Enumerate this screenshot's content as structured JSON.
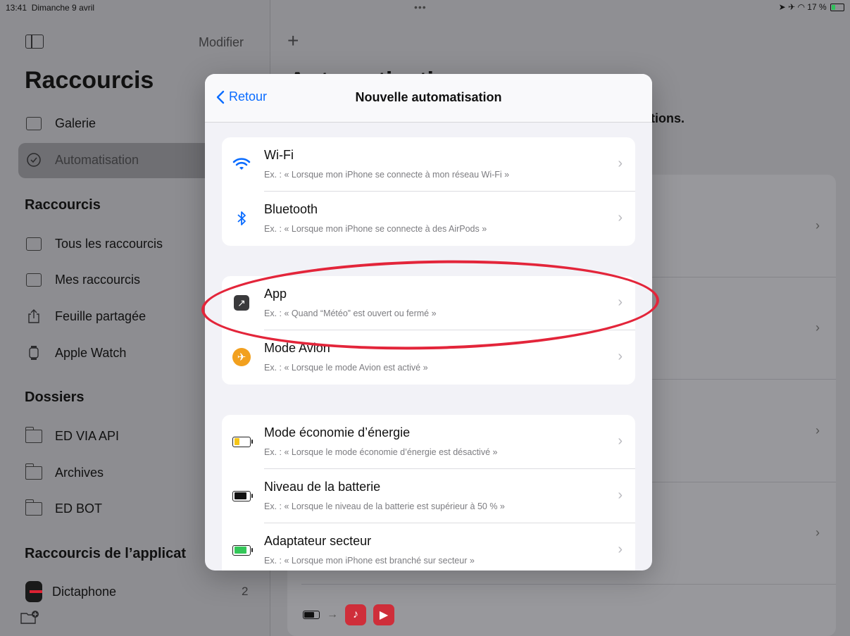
{
  "status_bar": {
    "time": "13:41",
    "date": "Dimanche 9 avril",
    "multitask_dots": "•••",
    "battery_percent": "17 %"
  },
  "sidebar": {
    "edit_label": "Modifier",
    "title": "Raccourcis",
    "top_items": [
      {
        "label": "Galerie",
        "icon": "gallery-icon"
      },
      {
        "label": "Automatisation",
        "icon": "clock-check-icon",
        "selected": true
      }
    ],
    "section_shortcuts": "Raccourcis",
    "shortcut_items": [
      {
        "label": "Tous les raccourcis",
        "icon": "stack-icon"
      },
      {
        "label": "Mes raccourcis",
        "icon": "person-stack-icon"
      },
      {
        "label": "Feuille partagée",
        "icon": "share-icon"
      },
      {
        "label": "Apple Watch",
        "icon": "watch-icon"
      }
    ],
    "section_folders": "Dossiers",
    "folders": [
      {
        "label": "ED VIA API"
      },
      {
        "label": "Archives"
      },
      {
        "label": "ED BOT"
      }
    ],
    "section_app_shortcuts": "Raccourcis de l’applicat",
    "app_shortcuts": [
      {
        "label": "Dictaphone",
        "count": "2"
      }
    ]
  },
  "main": {
    "title": "Automatisation",
    "subtitle_fragment": "tions."
  },
  "modal": {
    "back_label": "Retour",
    "title": "Nouvelle automatisation",
    "groups": [
      [
        {
          "title": "Wi-Fi",
          "subtitle": "Ex. : « Lorsque mon iPhone se connecte à mon réseau Wi-Fi »",
          "icon": "wifi-icon"
        },
        {
          "title": "Bluetooth",
          "subtitle": "Ex. : « Lorsque mon iPhone se connecte à des AirPods »",
          "icon": "bluetooth-icon"
        }
      ],
      [
        {
          "title": "App",
          "subtitle": "Ex. : « Quand “Météo” est ouvert ou fermé »",
          "icon": "app-icon",
          "highlighted": true
        },
        {
          "title": "Mode Avion",
          "subtitle": "Ex. : « Lorsque le mode Avion est activé »",
          "icon": "airplane-icon"
        }
      ],
      [
        {
          "title": "Mode économie d’énergie",
          "subtitle": "Ex. : « Lorsque le mode économie d’énergie est désactivé »",
          "icon": "low-power-battery-icon"
        },
        {
          "title": "Niveau de la batterie",
          "subtitle": "Ex. : « Lorsque le niveau de la batterie est supérieur à 50 % »",
          "icon": "battery-level-icon"
        },
        {
          "title": "Adaptateur secteur",
          "subtitle": "Ex. : « Lorsque mon iPhone est branché sur secteur »",
          "icon": "charging-battery-icon"
        }
      ]
    ]
  },
  "colors": {
    "accent_blue": "#0a6cff",
    "highlight_red": "#e3253a",
    "airplane_orange": "#f2a01e",
    "low_power_yellow": "#f5c518",
    "charging_green": "#34c759"
  }
}
